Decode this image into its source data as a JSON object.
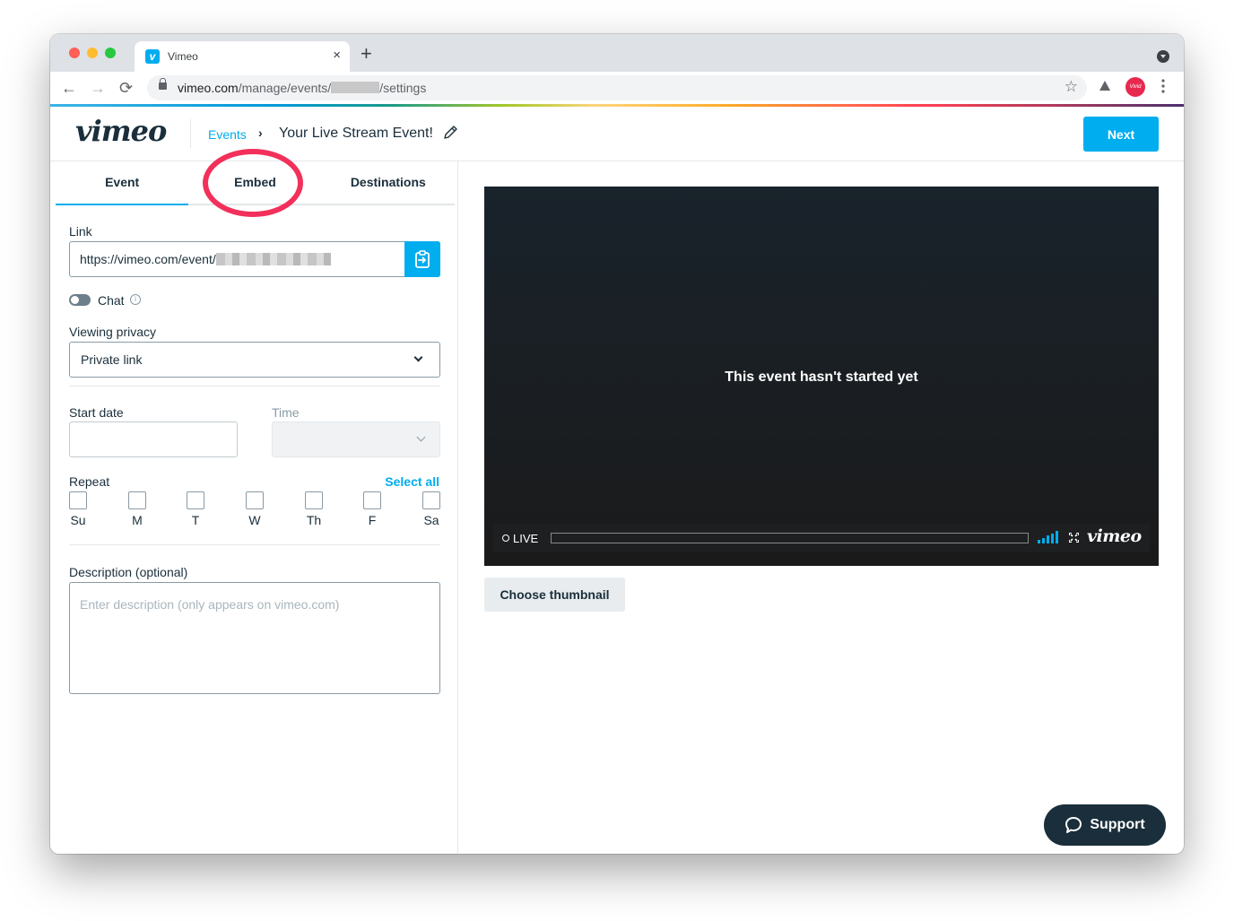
{
  "browser": {
    "tab_title": "Vimeo",
    "tab_favicon": "v",
    "tab_close": "×",
    "new_tab": "+",
    "url_host": "vimeo.com",
    "url_path_prefix": "/manage/events/",
    "url_path_suffix": "/settings",
    "profile_label": "Vivid Snaps",
    "back": "←",
    "forward": "→",
    "reload": "⟳",
    "star": "☆",
    "menu": "⋮"
  },
  "header": {
    "logo": "vimeo",
    "breadcrumb_link": "Events",
    "breadcrumb_separator": "›",
    "title": "Your Live Stream Event!",
    "next_label": "Next"
  },
  "tabs": [
    {
      "label": "Event",
      "active": true
    },
    {
      "label": "Embed",
      "active": false
    },
    {
      "label": "Destinations",
      "active": false
    }
  ],
  "form": {
    "link_label": "Link",
    "link_value": "https://vimeo.com/event/",
    "chat_label": "Chat",
    "chat_enabled": false,
    "info_glyph": "i",
    "privacy_label": "Viewing privacy",
    "privacy_value": "Private link",
    "start_date_label": "Start date",
    "start_date_value": "",
    "time_label": "Time",
    "repeat_label": "Repeat",
    "select_all_label": "Select all",
    "days": [
      "Su",
      "M",
      "T",
      "W",
      "Th",
      "F",
      "Sa"
    ],
    "description_label": "Description (optional)",
    "description_placeholder": "Enter description (only appears on vimeo.com)"
  },
  "player": {
    "message": "This event hasn't started yet",
    "live_label": "LIVE",
    "logo": "vimeo",
    "choose_thumbnail_label": "Choose thumbnail"
  },
  "support": {
    "label": "Support"
  },
  "colors": {
    "accent": "#00adef",
    "dark": "#1a2e3b",
    "annotation": "#f2305a"
  }
}
